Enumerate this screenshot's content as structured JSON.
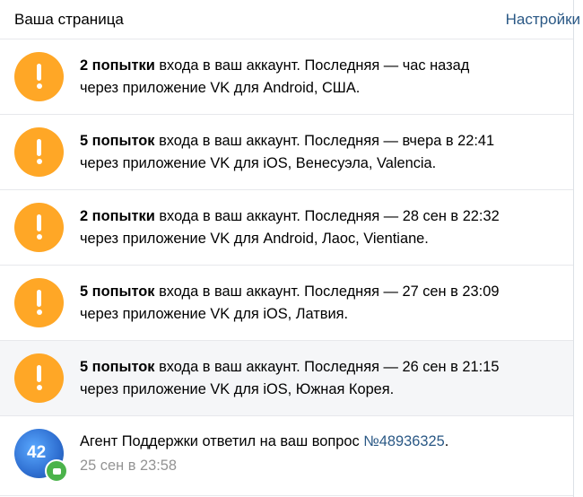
{
  "header": {
    "title": "Ваша страница",
    "settings_label": "Настройки"
  },
  "alerts": [
    {
      "count": "2 попытки",
      "line1_rest": " входа в ваш аккаунт. Последняя — час назад",
      "line2": "через приложение VK для Android, США."
    },
    {
      "count": "5 попыток",
      "line1_rest": " входа в ваш аккаунт. Последняя — вчера в 22:41",
      "line2": "через приложение VK для iOS, Венесуэла, Valencia."
    },
    {
      "count": "2 попытки",
      "line1_rest": " входа в ваш аккаунт. Последняя — 28 сен в 22:32",
      "line2": "через приложение VK для Android, Лаос, Vientiane."
    },
    {
      "count": "5 попыток",
      "line1_rest": " входа в ваш аккаунт. Последняя — 27 сен в 23:09",
      "line2": "через приложение VK для iOS, Латвия."
    },
    {
      "count": "5 попыток",
      "line1_rest": " входа в ваш аккаунт. Последняя — 26 сен в 21:15",
      "line2": "через приложение VK для iOS, Южная Корея."
    }
  ],
  "support": {
    "avatar_text": "42",
    "text": "Агент Поддержки ответил на ваш вопрос ",
    "ticket_link": "№48936325",
    "period": ".",
    "date": "25 сен в 23:58"
  },
  "colors": {
    "alert_icon": "#ffa726",
    "link": "#2a5885",
    "badge": "#4bb34b",
    "highlight_row": "#f5f6f8"
  },
  "icons": {
    "alert": "exclamation-icon",
    "support_badge": "message-icon"
  }
}
